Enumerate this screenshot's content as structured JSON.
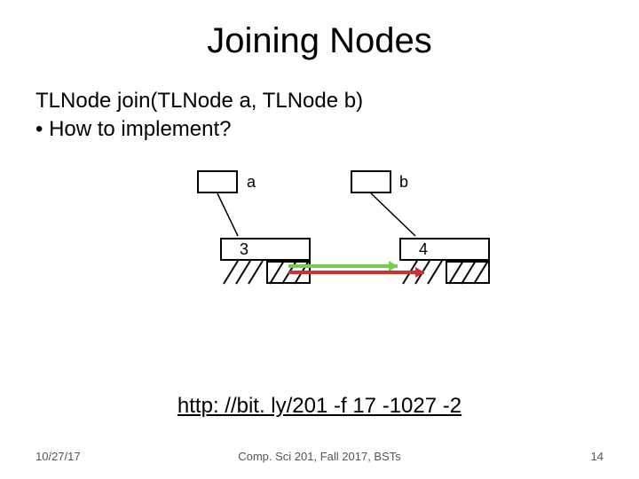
{
  "title": "Joining Nodes",
  "signature": "TLNode join(TLNode a, TLNode b)",
  "bullet1": "•  How to implement?",
  "diagram": {
    "label_a": "a",
    "label_b": "b",
    "node3_val": "3",
    "node4_val": "4"
  },
  "link": "http: //bit. ly/201 -f 17 -1027 -2",
  "footer": {
    "date": "10/27/17",
    "course": "Comp. Sci 201, Fall 2017,  BSTs",
    "page": "14"
  }
}
